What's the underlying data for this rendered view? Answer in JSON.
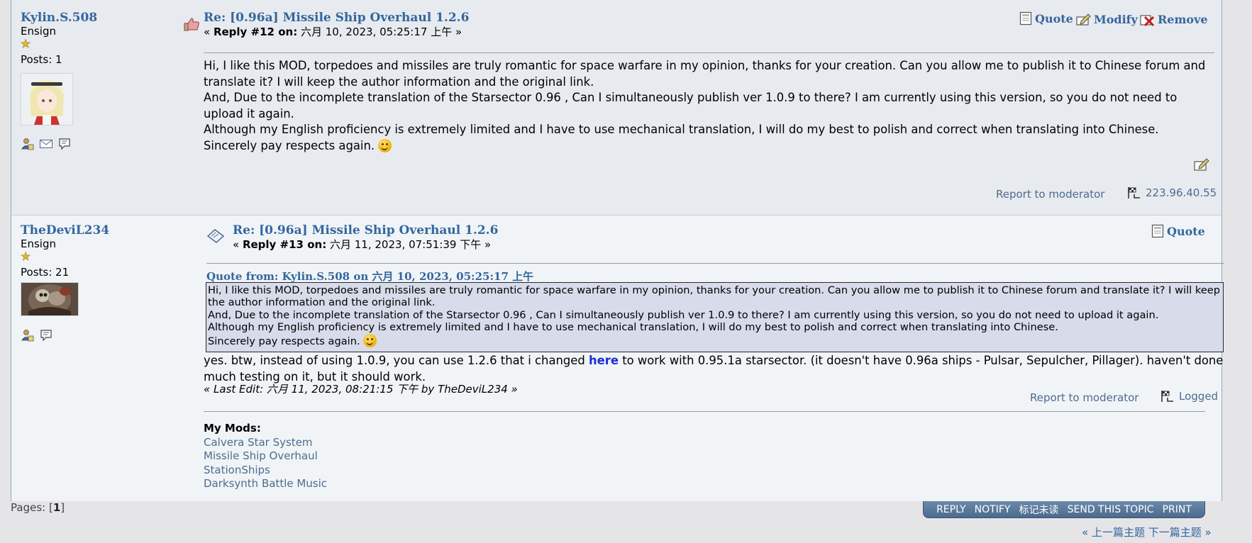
{
  "posts": [
    {
      "author": "Kylin.S.508",
      "rank": "Ensign",
      "rank_star": "★",
      "posts_count": "Posts: 1",
      "subject": "Re: [0.96a] Missile Ship Overhaul 1.2.6",
      "reply_prefix": "« ",
      "reply_label": "Reply #12 on:",
      "reply_date": " 六月 10, 2023, 05:25:17 上午 »",
      "actions": {
        "quote": "Quote",
        "modify": "Modify",
        "remove": "Remove"
      },
      "body": [
        "Hi, I like this MOD, torpedoes and missiles are truly romantic for space warfare in my opinion, thanks for your creation. Can you allow me to publish it to Chinese forum and translate it? I will keep the author information and the original link.",
        "And, Due to the incomplete translation of the Starsector 0.96 , Can I simultaneously publish ver 1.0.9 to there? I am currently using this version, so you do not need to upload it again.",
        "Although my English proficiency is extremely limited and I have to use mechanical translation, I will do my best to polish and correct when translating into Chinese.",
        "Sincerely pay respects again. "
      ],
      "report": "Report to moderator",
      "ip": "223.96.40.55",
      "user_icons": [
        "profile-icon",
        "email-icon",
        "pm-icon"
      ]
    },
    {
      "author": "TheDeviL234",
      "rank": "Ensign",
      "rank_star": "★",
      "posts_count": "Posts: 21",
      "subject": "Re: [0.96a] Missile Ship Overhaul 1.2.6",
      "reply_prefix": "« ",
      "reply_label": "Reply #13 on:",
      "reply_date": " 六月 11, 2023, 07:51:39 下午 »",
      "actions": {
        "quote": "Quote"
      },
      "quote_header": "Quote from: Kylin.S.508 on 六月 10, 2023, 05:25:17 上午",
      "quote_body": [
        "Hi, I like this MOD, torpedoes and missiles are truly romantic for space warfare in my opinion, thanks for your creation. Can you allow me to publish it to Chinese forum and translate it? I will keep the author information and the original link.",
        "And, Due to the incomplete translation of the Starsector 0.96 , Can I simultaneously publish ver 1.0.9 to there? I am currently using this version, so you do not need to upload it again.",
        "Although my English proficiency is extremely limited and I have to use mechanical translation, I will do my best to polish and correct when translating into Chinese.",
        "Sincerely pay respects again. "
      ],
      "reply_text_before": "yes. btw, instead of using 1.0.9, you can use 1.2.6 that i changed ",
      "reply_link": "here",
      "reply_text_after": " to work with 0.95.1a starsector. (it doesn't have 0.96a ships - Pulsar, Sepulcher, Pillager). haven't done much testing on it, but it should work.",
      "last_edit": "« Last Edit: 六月 11, 2023, 08:21:15 下午 by TheDeviL234 »",
      "report": "Report to moderator",
      "logged": "Logged",
      "signature_title": "My Mods:",
      "signature_links": [
        "Calvera Star System",
        "Missile Ship Overhaul",
        "StationShips",
        "Darksynth Battle Music"
      ],
      "user_icons": [
        "profile-icon",
        "pm-icon"
      ]
    }
  ],
  "pages": {
    "label": "Pages: [",
    "current": "1",
    "close": "]"
  },
  "navbar": [
    "REPLY",
    "NOTIFY",
    "标记未读",
    "SEND THIS TOPIC",
    "PRINT"
  ],
  "prevnext": "« 上一篇主题 下一篇主题 »",
  "colors": {
    "link": "#34669d",
    "quote_bg": "#d7dbea",
    "navbar": "#4b6a8e",
    "star": "#e8b825"
  }
}
